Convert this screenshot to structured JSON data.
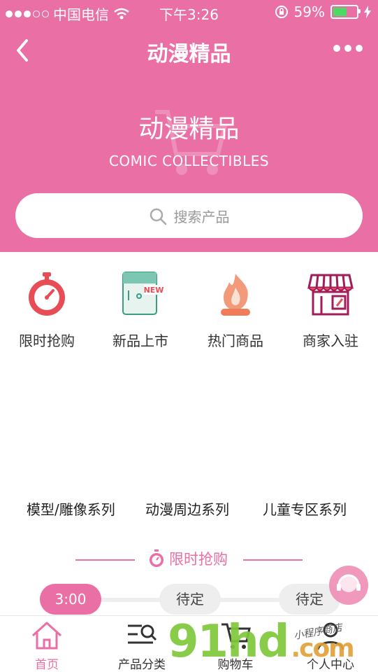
{
  "status_bar": {
    "carrier": "中国电信",
    "time": "下午3:26",
    "battery": "59%",
    "battery_level": 0.59
  },
  "nav": {
    "title": "动漫精品"
  },
  "hero": {
    "title": "动漫精品",
    "subtitle": "COMIC COLLECTIBLES"
  },
  "search": {
    "placeholder": "搜索产品"
  },
  "categories": [
    {
      "label": "限时抢购",
      "icon": "stopwatch-icon"
    },
    {
      "label": "新品上市",
      "icon": "new-pocket-icon",
      "badge": "NEW"
    },
    {
      "label": "热门商品",
      "icon": "fire-icon"
    },
    {
      "label": "商家入驻",
      "icon": "storefront-icon"
    }
  ],
  "series": [
    "模型/雕像系列",
    "动漫周边系列",
    "儿童专区系列"
  ],
  "flash_sale": {
    "title": "限时抢购",
    "slots": [
      "3:00",
      "待定",
      "待定"
    ]
  },
  "tabs": [
    {
      "label": "首页",
      "icon": "home-icon"
    },
    {
      "label": "产品分类",
      "icon": "category-search-icon"
    },
    {
      "label": "购物车",
      "icon": "cart-icon"
    },
    {
      "label": "个人中心",
      "icon": "user-icon"
    }
  ],
  "watermark": {
    "brand": "91hd",
    "suffix": ".com",
    "small": "小程序商店"
  },
  "colors": {
    "brand": "#e96fa5",
    "battery": "#4cd964"
  }
}
